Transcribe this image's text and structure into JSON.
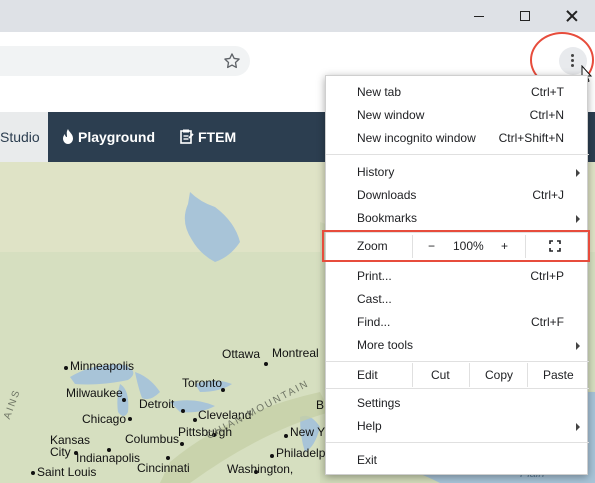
{
  "window": {
    "controls": [
      "minimize",
      "maximize",
      "close"
    ]
  },
  "toolbar": {
    "bookmark_icon": "star-icon",
    "menu_icon": "kebab-menu-icon"
  },
  "sitenav": {
    "studio": "Studio",
    "playground": "Playground",
    "ftem": "FTEM"
  },
  "map": {
    "labels": {
      "minneapolis": "Minneapolis",
      "ottawa": "Ottawa",
      "montreal": "Montreal",
      "milwaukee": "Milwaukee",
      "toronto": "Toronto",
      "detroit": "Detroit",
      "chicago": "Chicago",
      "cleveland": "Cleveland",
      "kansas": "Kansas",
      "city": "City",
      "columbus": "Columbus",
      "pittsburgh": "Pittsburgh",
      "newy": "New Y",
      "indianapolis": "Indianapolis",
      "philadelph": "Philadelph",
      "saint_louis": "Saint Louis",
      "cincinnati": "Cincinnati",
      "washington": "Washington,",
      "appalachian": "CHIAN MOUNTAIN",
      "b_edge": "B",
      "ains": "AINS",
      "plain": "Plain"
    },
    "colors": {
      "land": "#d6dfc0",
      "water": "#a8c4d8"
    }
  },
  "menu": {
    "new_tab": "New tab",
    "new_tab_sc": "Ctrl+T",
    "new_window": "New window",
    "new_window_sc": "Ctrl+N",
    "incognito": "New incognito window",
    "incognito_sc": "Ctrl+Shift+N",
    "history": "History",
    "downloads": "Downloads",
    "downloads_sc": "Ctrl+J",
    "bookmarks": "Bookmarks",
    "zoom": "Zoom",
    "zoom_minus": "−",
    "zoom_value": "100%",
    "zoom_plus": "+",
    "print": "Print...",
    "print_sc": "Ctrl+P",
    "cast": "Cast...",
    "find": "Find...",
    "find_sc": "Ctrl+F",
    "more_tools": "More tools",
    "edit": "Edit",
    "cut": "Cut",
    "copy": "Copy",
    "paste": "Paste",
    "settings": "Settings",
    "help": "Help",
    "exit": "Exit"
  },
  "highlight_color": "#e74c3c"
}
